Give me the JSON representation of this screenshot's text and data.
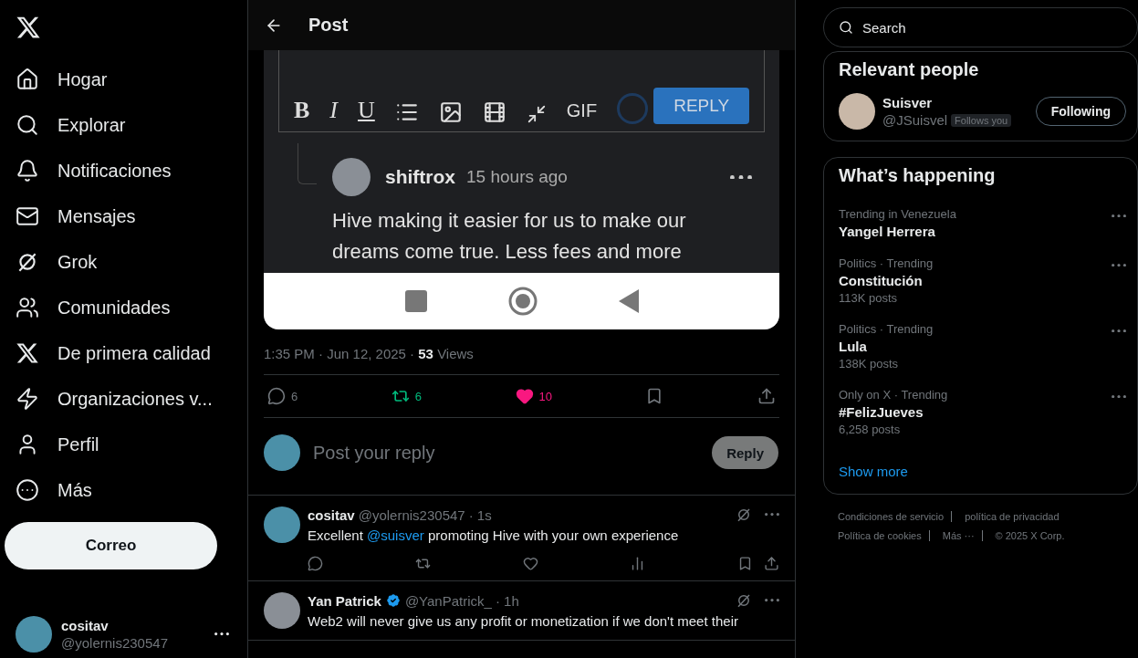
{
  "nav": {
    "items": [
      {
        "kind": "home",
        "label": "Hogar"
      },
      {
        "kind": "search",
        "label": "Explorar"
      },
      {
        "kind": "bell",
        "label": "Notificaciones"
      },
      {
        "kind": "mail",
        "label": "Mensajes"
      },
      {
        "kind": "grok",
        "label": "Grok"
      },
      {
        "kind": "people",
        "label": "Comunidades"
      },
      {
        "kind": "x",
        "label": "De primera calidad"
      },
      {
        "kind": "bolt",
        "label": "Organizaciones v..."
      },
      {
        "kind": "person",
        "label": "Perfil"
      },
      {
        "kind": "more",
        "label": "Más"
      }
    ],
    "post_button": "Correo",
    "account": {
      "name": "cositav",
      "handle": "@yolernis230547"
    }
  },
  "header": {
    "title": "Post"
  },
  "post": {
    "embed": {
      "format_buttons": [
        "B",
        "I",
        "U"
      ],
      "gif": "GIF",
      "submit": "REPLY",
      "comment": {
        "author": "shiftrox",
        "time": "15 hours ago",
        "text": "Hive making it easier for us to make our dreams come true. Less fees and more"
      }
    },
    "meta": {
      "time": "1:35 PM · Jun 12, 2025 · ",
      "views_count": "53",
      "views_label": "Views"
    },
    "actions": [
      {
        "kind": "reply",
        "count": "6",
        "active": false
      },
      {
        "kind": "repost",
        "count": "6",
        "active": true
      },
      {
        "kind": "like",
        "count": "10",
        "active": true
      },
      {
        "kind": "bookmark",
        "active": false
      },
      {
        "kind": "share",
        "active": false
      }
    ]
  },
  "reply_box": {
    "placeholder": "Post your reply",
    "button": "Reply"
  },
  "replies": [
    {
      "name": "cositav",
      "verified": false,
      "handle": "@yolernis230547",
      "time": "· 1s",
      "text_before": "Excellent ",
      "mention": "@suisver",
      "text_after": " promoting Hive with your own experience",
      "actions": true
    },
    {
      "name": "Yan Patrick",
      "verified": true,
      "handle": "@YanPatrick_",
      "time": "· 1h",
      "text_before": "Web2 will never give us any profit or monetization if we don't meet their",
      "actions": false
    }
  ],
  "sidebar": {
    "search": {
      "placeholder": "Search"
    },
    "relevant_people": {
      "title": "Relevant people",
      "people": [
        {
          "name": "Suisver",
          "handle": "@JSuisvel",
          "badge": "Follows you",
          "button": "Following"
        }
      ]
    },
    "trends": {
      "title": "What’s happening",
      "items": [
        {
          "context": "Trending in Venezuela",
          "name": "Yangel Herrera"
        },
        {
          "context": "Politics · Trending",
          "name": "Constitución",
          "posts": "113K posts"
        },
        {
          "context": "Politics · Trending",
          "name": "Lula",
          "posts": "138K posts"
        },
        {
          "context": "Only on X · Trending",
          "name": "#FelizJueves",
          "posts": "6,258 posts"
        }
      ],
      "show_more": "Show more"
    },
    "footer": [
      [
        "Condiciones de servicio",
        "política de privacidad"
      ],
      [
        "Política de cookies",
        "Más ···",
        "© 2025 X Corp."
      ]
    ]
  }
}
